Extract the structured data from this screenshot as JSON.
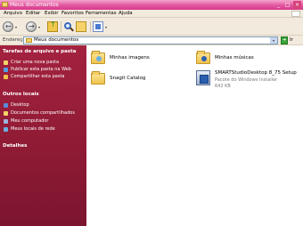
{
  "window": {
    "title": "Meus documentos",
    "minimize": "_",
    "maximize": "□",
    "close": "×"
  },
  "menu": [
    "Arquivo",
    "Editar",
    "Exibir",
    "Favoritos",
    "Ferramentas",
    "Ajuda"
  ],
  "toolbar": {
    "back_icon": "back-arrow-icon",
    "forward_icon": "forward-arrow-icon",
    "up_icon": "up-folder-icon",
    "search_icon": "search-icon",
    "folders_icon": "folders-icon",
    "views_icon": "views-icon",
    "back_glyph": "←",
    "forward_glyph": "→",
    "dropdown_glyph": "▾"
  },
  "address": {
    "label": "Endereço",
    "value": "Meus documentos",
    "go_label": "Ir",
    "go_glyph": "➜"
  },
  "sidebar": {
    "sections": [
      {
        "title": "Tarefas de arquivo e pasta",
        "items": [
          {
            "label": "Criar uma nova pasta",
            "icon": "new-folder-icon"
          },
          {
            "label": "Publicar esta pasta na Web",
            "icon": "publish-web-icon"
          },
          {
            "label": "Compartilhar esta pasta",
            "icon": "share-folder-icon"
          }
        ]
      },
      {
        "title": "Outros locais",
        "items": [
          {
            "label": "Desktop",
            "icon": "desktop-icon"
          },
          {
            "label": "Documentos compartilhados",
            "icon": "shared-documents-icon"
          },
          {
            "label": "Meu computador",
            "icon": "my-computer-icon"
          },
          {
            "label": "Meus locais de rede",
            "icon": "network-places-icon"
          }
        ]
      },
      {
        "title": "Detalhes",
        "items": []
      }
    ]
  },
  "files": [
    {
      "name": "Minhas imagens",
      "type": "folder",
      "icon": "pictures-folder-icon"
    },
    {
      "name": "Minhas músicas",
      "type": "folder",
      "icon": "music-folder-icon"
    },
    {
      "name": "Snagit Catalog",
      "type": "folder",
      "icon": "folder-icon"
    },
    {
      "name": "SMARTStudioDesktop 8_75 Setup",
      "type": "installer",
      "icon": "installer-package-icon",
      "detail": "Pacote do Windows Installer",
      "size": "642 KB"
    }
  ],
  "colors": {
    "titlebar": "#e2569f",
    "sidebar": "#8e1a34",
    "chrome": "#f2eadd"
  }
}
